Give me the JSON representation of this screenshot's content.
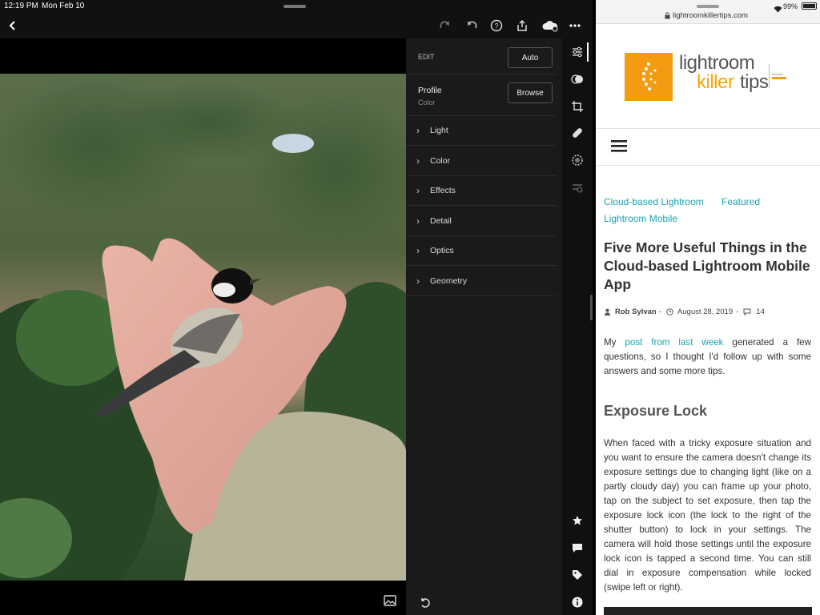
{
  "status_bar": {
    "time": "12:19 PM",
    "date": "Mon Feb 10",
    "battery": "99%"
  },
  "editor": {
    "edit_label": "EDIT",
    "auto_button": "Auto",
    "profile_label": "Profile",
    "profile_value": "Color",
    "browse_button": "Browse",
    "sections": [
      {
        "label": "Light"
      },
      {
        "label": "Color"
      },
      {
        "label": "Effects"
      },
      {
        "label": "Detail"
      },
      {
        "label": "Optics"
      },
      {
        "label": "Geometry"
      }
    ]
  },
  "browser": {
    "url": "lightroomkillertips.com",
    "logo_line1": "lightroom",
    "logo_line2": "killer",
    "logo_line3": "tips",
    "categories": [
      "Cloud-based Lightroom",
      "Featured",
      "Lightroom Mobile"
    ],
    "title": "Five More Useful Things in the Cloud-based Lightroom Mobile App",
    "author": "Rob Sylvan",
    "date": "August 28, 2019",
    "comments": "14",
    "intro_pre": "My",
    "intro_link": "post from last week",
    "intro_post": "generated a few questions, so I thought I'd follow up with some answers and some more tips.",
    "section_heading": "Exposure Lock",
    "body_paragraph": "When faced with a tricky exposure situation and you want to ensure the camera doesn't change its exposure settings due to changing light (like on a partly cloudy day) you can frame up your photo, tap on the subject to set exposure, then tap the exposure lock icon (the lock to the right of the shutter button) to lock in your settings. The camera will hold those settings until the exposure lock icon is tapped a second time. You can still dial in exposure compensation while locked (swipe left or right)."
  },
  "colors": {
    "accent_teal": "#1aa3b1",
    "logo_orange": "#f39c12",
    "logo_yellow": "#f5a800"
  }
}
